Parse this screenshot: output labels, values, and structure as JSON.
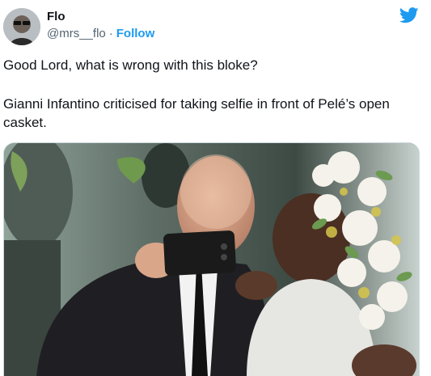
{
  "tweet": {
    "author_name": "Flo",
    "handle": "@mrs__flo",
    "separator": "·",
    "follow_label": "Follow",
    "text_line1": "Good Lord, what is wrong with this bloke?",
    "text_line2": "Gianni Infantino criticised for taking selfie in front of Pelé’s open casket."
  },
  "colors": {
    "twitter_blue": "#1d9bf0",
    "text_primary": "#0f1419",
    "text_secondary": "#536471",
    "border": "#cfd9de"
  },
  "icons": {
    "brand": "twitter-bird-icon"
  }
}
